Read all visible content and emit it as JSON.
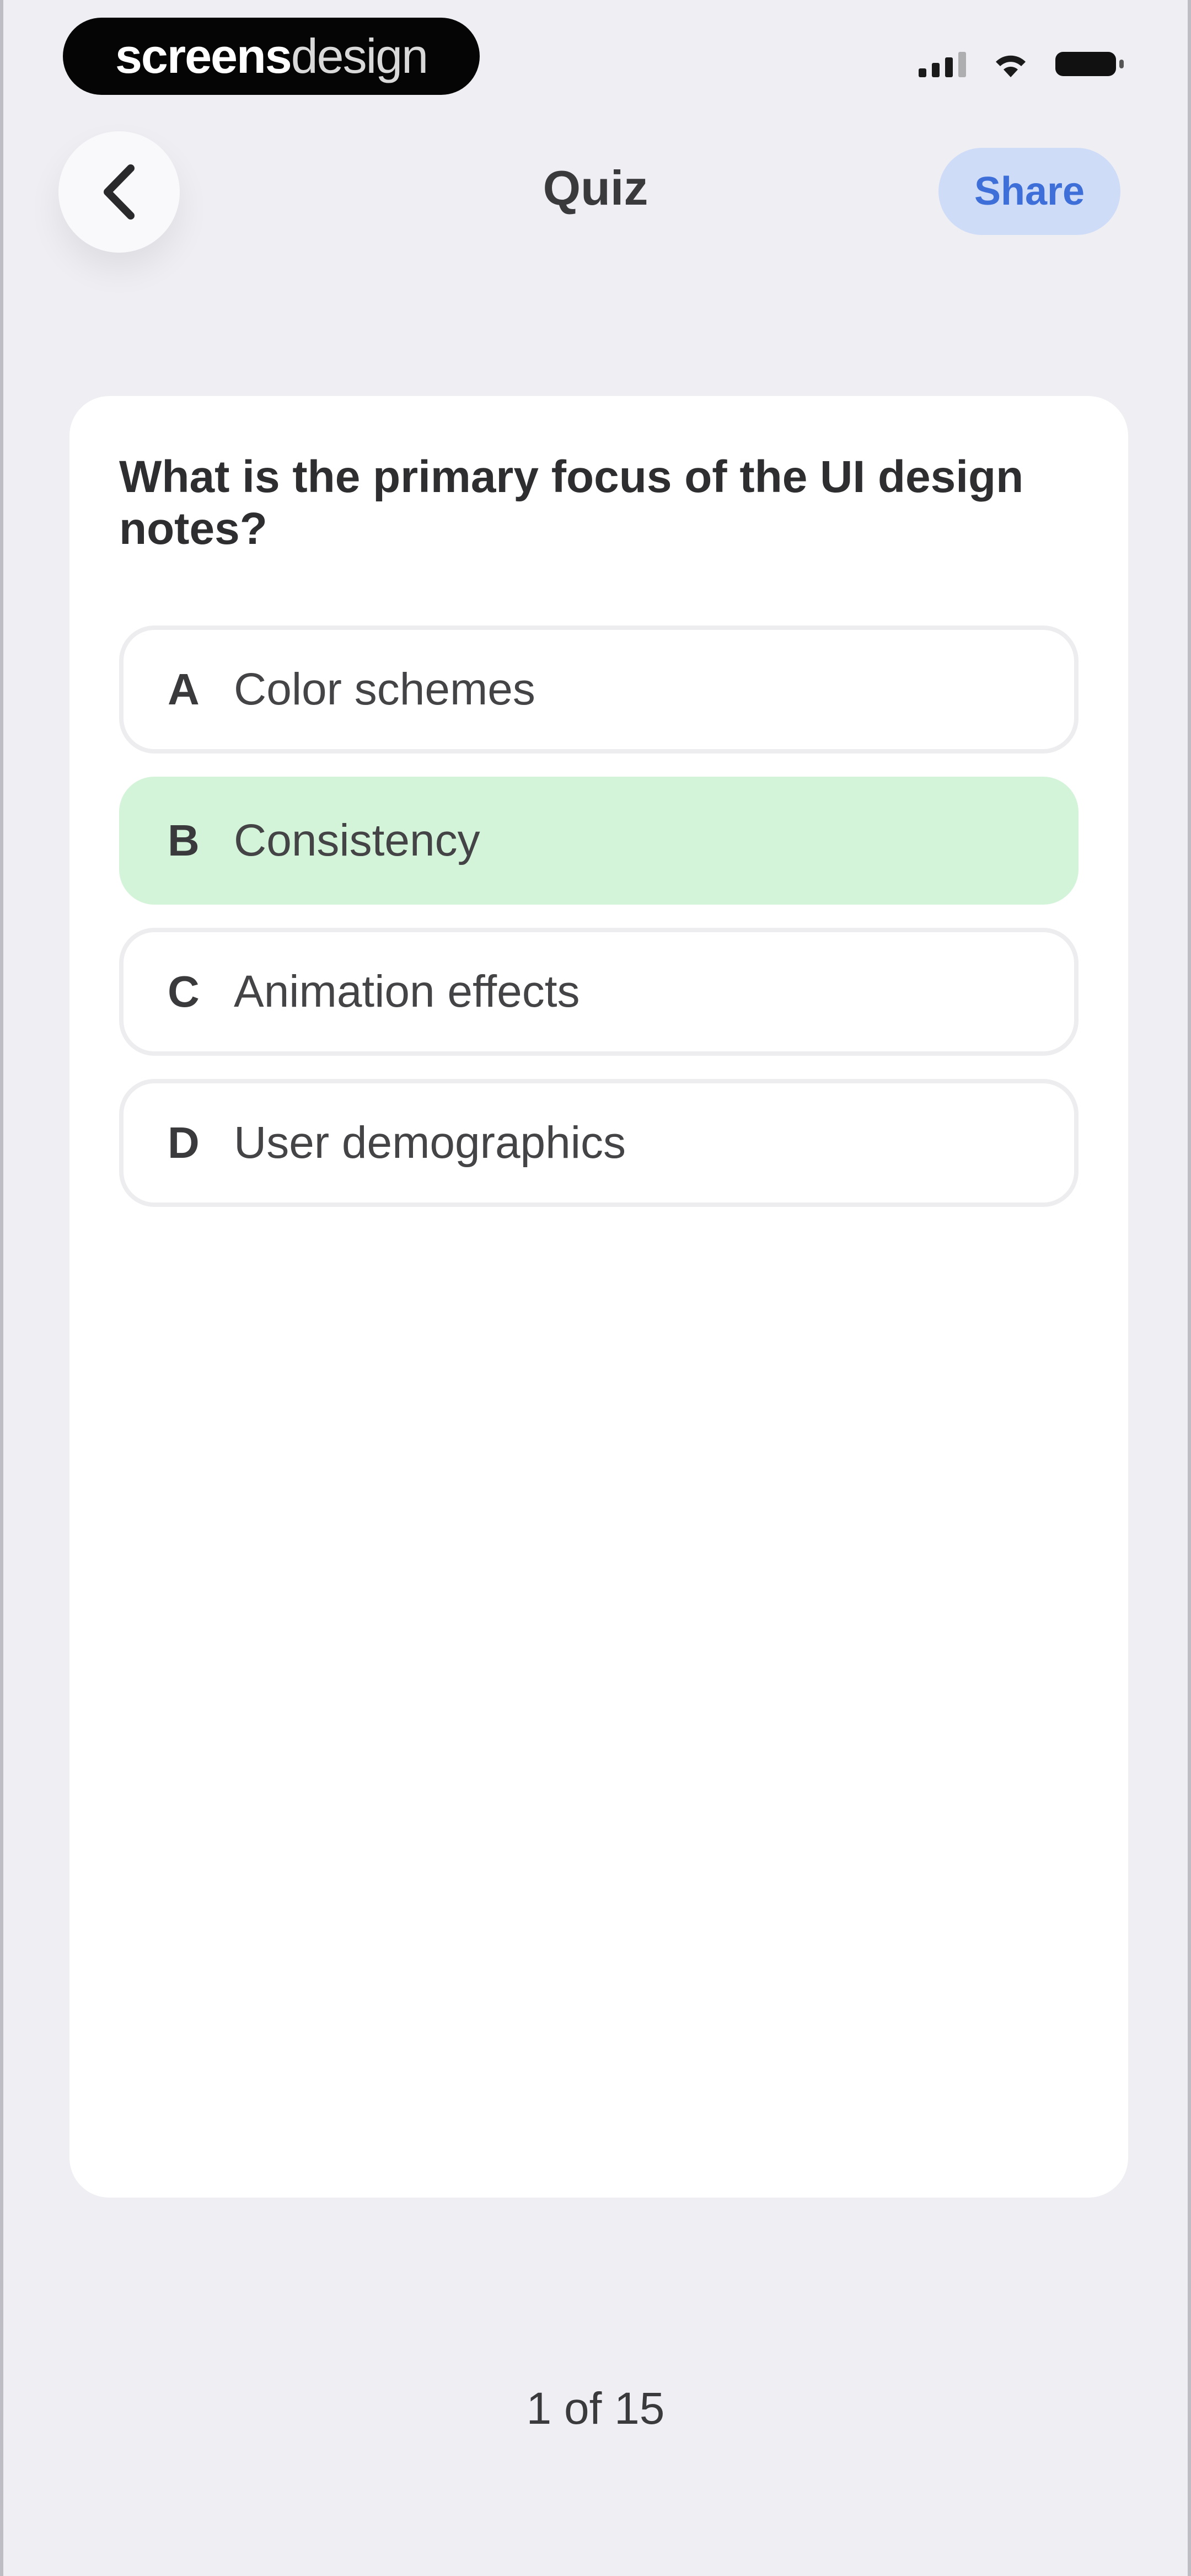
{
  "status_bar": {
    "brand_strong": "screens",
    "brand_light": "design",
    "icons": [
      "signal-icon",
      "wifi-icon",
      "battery-icon"
    ]
  },
  "nav": {
    "back_icon": "chevron-left-icon",
    "title": "Quiz",
    "share_label": "Share"
  },
  "quiz": {
    "question": "What is the primary focus of the UI design notes?",
    "options": [
      {
        "letter": "A",
        "text": "Color schemes",
        "selected": false
      },
      {
        "letter": "B",
        "text": "Consistency",
        "selected": true
      },
      {
        "letter": "C",
        "text": "Animation effects",
        "selected": false
      },
      {
        "letter": "D",
        "text": "User demographics",
        "selected": false
      }
    ],
    "selected_color": "#D3F4D8"
  },
  "pagination": {
    "label": "1 of 15"
  },
  "colors": {
    "background": "#EEEEF3",
    "accent": "#3E6FD8",
    "share_bg": "#CFDCF8"
  }
}
